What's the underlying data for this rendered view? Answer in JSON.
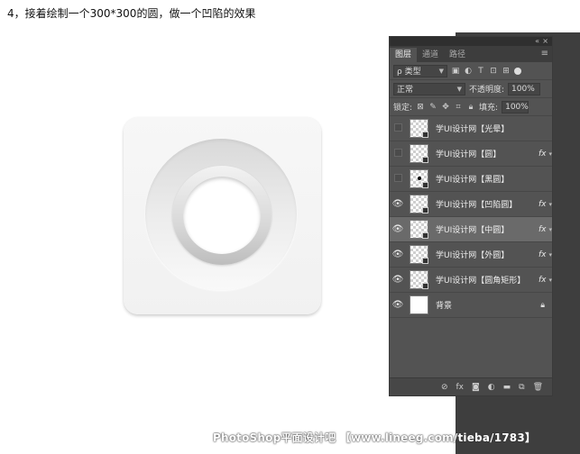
{
  "instruction": "4，接着绘制一个300*300的圆，做一个凹陷的效果",
  "panel": {
    "collapse": "«",
    "close": "×",
    "tabs": [
      "图层",
      "通道",
      "路径"
    ],
    "menu_glyph": "≡",
    "filter": {
      "label": "类型",
      "icons": [
        "image-filter-icon",
        "adjustment-filter-icon",
        "type-filter-icon",
        "shape-filter-icon",
        "smart-object-filter-icon"
      ]
    },
    "blend_mode": "正常",
    "opacity_label": "不透明度:",
    "opacity_value": "100%",
    "lock_label": "锁定:",
    "fill_label": "填充:",
    "fill_value": "100%",
    "layers": [
      {
        "name": "学UI设计网【光晕】",
        "visible": false,
        "fx": false,
        "selected": false,
        "thumb": "checker"
      },
      {
        "name": "学UI设计网【圆】",
        "visible": false,
        "fx": true,
        "selected": false,
        "thumb": "checker"
      },
      {
        "name": "学UI设计网【黑圆】",
        "visible": false,
        "fx": false,
        "selected": false,
        "thumb": "checker-dot"
      },
      {
        "name": "学UI设计网【凹陷圆】",
        "visible": true,
        "fx": true,
        "selected": false,
        "thumb": "checker"
      },
      {
        "name": "学UI设计网【中圆】",
        "visible": true,
        "fx": true,
        "selected": true,
        "thumb": "checker"
      },
      {
        "name": "学UI设计网【外圆】",
        "visible": true,
        "fx": true,
        "selected": false,
        "thumb": "checker"
      },
      {
        "name": "学UI设计网【圆角矩形】",
        "visible": true,
        "fx": true,
        "selected": false,
        "thumb": "checker"
      },
      {
        "name": "背景",
        "visible": true,
        "fx": false,
        "selected": false,
        "thumb": "white",
        "locked": true
      }
    ],
    "fx_label": "fx",
    "bottom_icons": [
      "link-layers-icon",
      "fx-icon",
      "add-mask-icon",
      "adjustment-layer-icon",
      "new-group-icon",
      "new-layer-icon",
      "delete-layer-icon"
    ]
  },
  "watermark": "PhotoShop平面设计吧 【www.lineeg.com/tieba/1783】"
}
